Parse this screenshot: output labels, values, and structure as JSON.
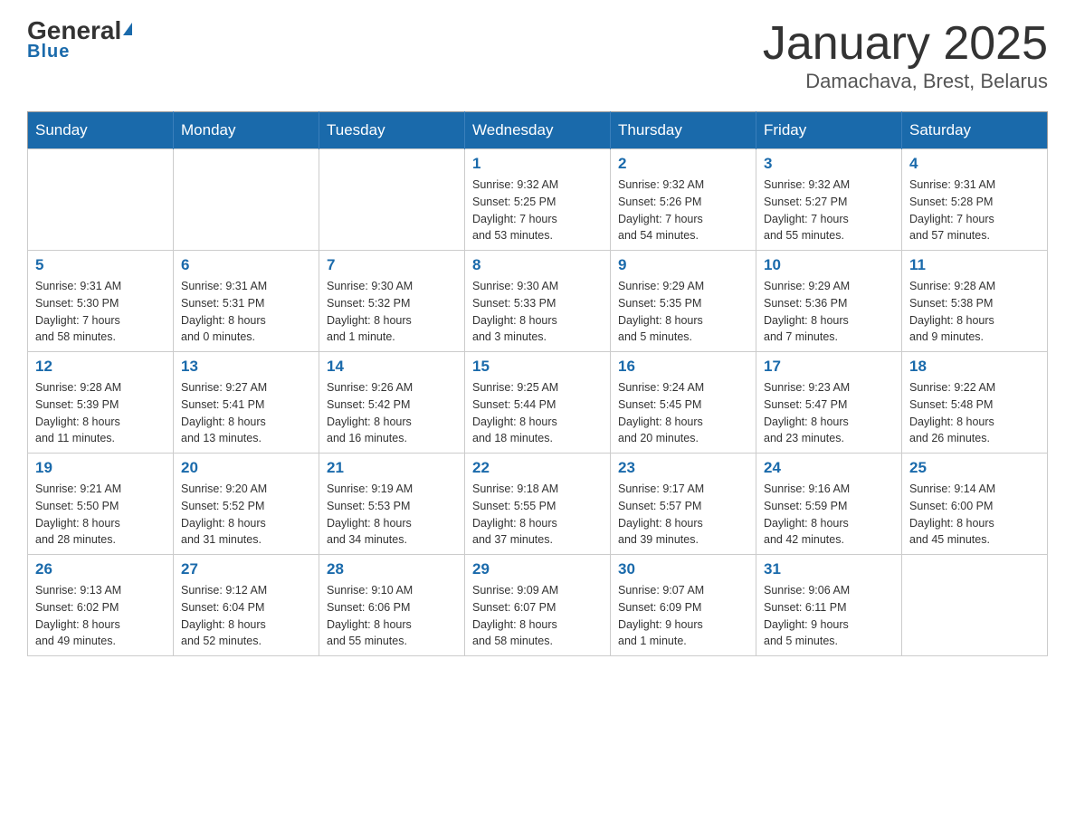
{
  "header": {
    "logo": {
      "general": "General",
      "blue": "Blue"
    },
    "title": "January 2025",
    "location": "Damachava, Brest, Belarus"
  },
  "calendar": {
    "days_of_week": [
      "Sunday",
      "Monday",
      "Tuesday",
      "Wednesday",
      "Thursday",
      "Friday",
      "Saturday"
    ],
    "weeks": [
      [
        {
          "day": "",
          "info": ""
        },
        {
          "day": "",
          "info": ""
        },
        {
          "day": "",
          "info": ""
        },
        {
          "day": "1",
          "info": "Sunrise: 9:32 AM\nSunset: 5:25 PM\nDaylight: 7 hours\nand 53 minutes."
        },
        {
          "day": "2",
          "info": "Sunrise: 9:32 AM\nSunset: 5:26 PM\nDaylight: 7 hours\nand 54 minutes."
        },
        {
          "day": "3",
          "info": "Sunrise: 9:32 AM\nSunset: 5:27 PM\nDaylight: 7 hours\nand 55 minutes."
        },
        {
          "day": "4",
          "info": "Sunrise: 9:31 AM\nSunset: 5:28 PM\nDaylight: 7 hours\nand 57 minutes."
        }
      ],
      [
        {
          "day": "5",
          "info": "Sunrise: 9:31 AM\nSunset: 5:30 PM\nDaylight: 7 hours\nand 58 minutes."
        },
        {
          "day": "6",
          "info": "Sunrise: 9:31 AM\nSunset: 5:31 PM\nDaylight: 8 hours\nand 0 minutes."
        },
        {
          "day": "7",
          "info": "Sunrise: 9:30 AM\nSunset: 5:32 PM\nDaylight: 8 hours\nand 1 minute."
        },
        {
          "day": "8",
          "info": "Sunrise: 9:30 AM\nSunset: 5:33 PM\nDaylight: 8 hours\nand 3 minutes."
        },
        {
          "day": "9",
          "info": "Sunrise: 9:29 AM\nSunset: 5:35 PM\nDaylight: 8 hours\nand 5 minutes."
        },
        {
          "day": "10",
          "info": "Sunrise: 9:29 AM\nSunset: 5:36 PM\nDaylight: 8 hours\nand 7 minutes."
        },
        {
          "day": "11",
          "info": "Sunrise: 9:28 AM\nSunset: 5:38 PM\nDaylight: 8 hours\nand 9 minutes."
        }
      ],
      [
        {
          "day": "12",
          "info": "Sunrise: 9:28 AM\nSunset: 5:39 PM\nDaylight: 8 hours\nand 11 minutes."
        },
        {
          "day": "13",
          "info": "Sunrise: 9:27 AM\nSunset: 5:41 PM\nDaylight: 8 hours\nand 13 minutes."
        },
        {
          "day": "14",
          "info": "Sunrise: 9:26 AM\nSunset: 5:42 PM\nDaylight: 8 hours\nand 16 minutes."
        },
        {
          "day": "15",
          "info": "Sunrise: 9:25 AM\nSunset: 5:44 PM\nDaylight: 8 hours\nand 18 minutes."
        },
        {
          "day": "16",
          "info": "Sunrise: 9:24 AM\nSunset: 5:45 PM\nDaylight: 8 hours\nand 20 minutes."
        },
        {
          "day": "17",
          "info": "Sunrise: 9:23 AM\nSunset: 5:47 PM\nDaylight: 8 hours\nand 23 minutes."
        },
        {
          "day": "18",
          "info": "Sunrise: 9:22 AM\nSunset: 5:48 PM\nDaylight: 8 hours\nand 26 minutes."
        }
      ],
      [
        {
          "day": "19",
          "info": "Sunrise: 9:21 AM\nSunset: 5:50 PM\nDaylight: 8 hours\nand 28 minutes."
        },
        {
          "day": "20",
          "info": "Sunrise: 9:20 AM\nSunset: 5:52 PM\nDaylight: 8 hours\nand 31 minutes."
        },
        {
          "day": "21",
          "info": "Sunrise: 9:19 AM\nSunset: 5:53 PM\nDaylight: 8 hours\nand 34 minutes."
        },
        {
          "day": "22",
          "info": "Sunrise: 9:18 AM\nSunset: 5:55 PM\nDaylight: 8 hours\nand 37 minutes."
        },
        {
          "day": "23",
          "info": "Sunrise: 9:17 AM\nSunset: 5:57 PM\nDaylight: 8 hours\nand 39 minutes."
        },
        {
          "day": "24",
          "info": "Sunrise: 9:16 AM\nSunset: 5:59 PM\nDaylight: 8 hours\nand 42 minutes."
        },
        {
          "day": "25",
          "info": "Sunrise: 9:14 AM\nSunset: 6:00 PM\nDaylight: 8 hours\nand 45 minutes."
        }
      ],
      [
        {
          "day": "26",
          "info": "Sunrise: 9:13 AM\nSunset: 6:02 PM\nDaylight: 8 hours\nand 49 minutes."
        },
        {
          "day": "27",
          "info": "Sunrise: 9:12 AM\nSunset: 6:04 PM\nDaylight: 8 hours\nand 52 minutes."
        },
        {
          "day": "28",
          "info": "Sunrise: 9:10 AM\nSunset: 6:06 PM\nDaylight: 8 hours\nand 55 minutes."
        },
        {
          "day": "29",
          "info": "Sunrise: 9:09 AM\nSunset: 6:07 PM\nDaylight: 8 hours\nand 58 minutes."
        },
        {
          "day": "30",
          "info": "Sunrise: 9:07 AM\nSunset: 6:09 PM\nDaylight: 9 hours\nand 1 minute."
        },
        {
          "day": "31",
          "info": "Sunrise: 9:06 AM\nSunset: 6:11 PM\nDaylight: 9 hours\nand 5 minutes."
        },
        {
          "day": "",
          "info": ""
        }
      ]
    ]
  }
}
